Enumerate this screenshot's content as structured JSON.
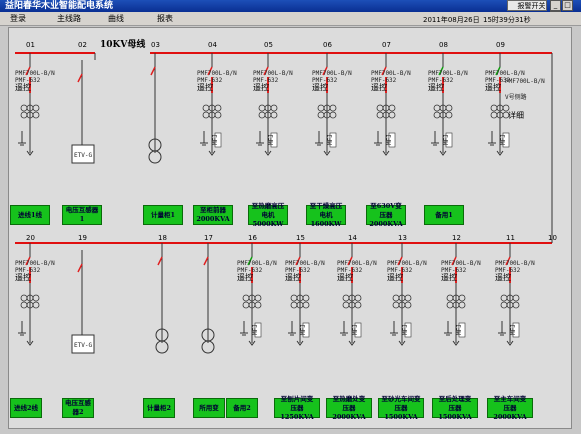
{
  "window": {
    "title": "益阳春华木业智能配电系统"
  },
  "menu": {
    "items": [
      "登录",
      "主线路",
      "曲线",
      "报表"
    ]
  },
  "status": {
    "alarm_label": "报警开关",
    "date": "2011年08月26日",
    "time": "15时39分31秒"
  },
  "bus": {
    "name": "10KV母线"
  },
  "device": {
    "model_a": "PMF700L-B/N",
    "model_b": "PMF-632",
    "remote": "遥控",
    "etv": "ETV-G",
    "mfj": "MFJ"
  },
  "top_row": {
    "numbers": [
      "01",
      "02",
      "03",
      "04",
      "05",
      "06",
      "07",
      "08",
      "09"
    ],
    "feeder_09_extra": "V号侧路",
    "detail": "详细",
    "buttons": [
      "进线1线",
      "电压互感器1",
      "计量柜1",
      "至柜前器\n2000KVA",
      "至热磨高压\n电机5000KW",
      "至干燥高压\n电机1600KW",
      "至630V变\n压器2000KVA",
      "备用1"
    ]
  },
  "bottom_row": {
    "numbers": [
      "20",
      "19",
      "18",
      "17",
      "16",
      "15",
      "14",
      "13",
      "12",
      "11",
      "10"
    ],
    "buttons": [
      "进线2线",
      "电压互感器2",
      "计量柜2",
      "所用变",
      "备用2",
      "至刨片间变\n压器1250KVA",
      "至热磨处变\n压器2000KVA",
      "至砂光车间变\n压器1500KVA",
      "至后处理变\n压器1500KVA",
      "至主车间变\n压器2000KVA"
    ]
  },
  "colors": {
    "bus": "#e01010",
    "button": "#16c21c",
    "breaker": "#e02020",
    "switch_green": "#10a010"
  }
}
